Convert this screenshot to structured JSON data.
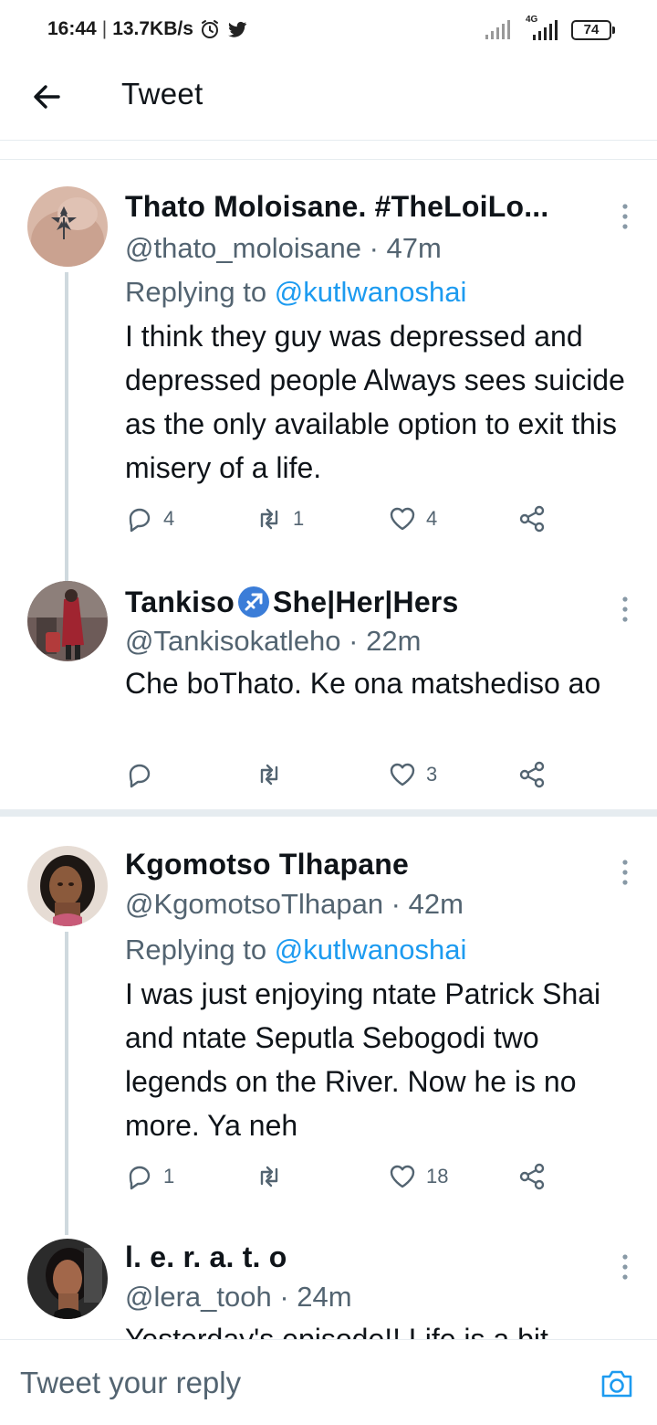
{
  "status_bar": {
    "time": "16:44",
    "net_speed": "13.7KB/s",
    "network_label": "4G",
    "battery": "74"
  },
  "header": {
    "title": "Tweet"
  },
  "tweets": [
    {
      "name": "Thato Moloisane. #TheLoiLo...",
      "handle_time": "@thato_moloisane · 47m",
      "replying_prefix": "Replying to ",
      "replying_to": "@kutlwanoshai",
      "text": "I think they guy was depressed and depressed people Always sees suicide as the only available option to exit this misery of a life.",
      "replies": "4",
      "retweets": "1",
      "likes": "4"
    },
    {
      "name": "Tankiso♐️She|Her|Hers",
      "name_plain": "Tankiso",
      "name_suffix": "She|Her|Hers",
      "handle_time": "@Tankisokatleho · 22m",
      "text": "Che boThato. Ke ona matshediso ao",
      "replies": "",
      "retweets": "",
      "likes": "3"
    },
    {
      "name": "Kgomotso Tlhapane",
      "handle_time": "@KgomotsoTlhapan · 42m",
      "replying_prefix": "Replying to ",
      "replying_to": "@kutlwanoshai",
      "text": "I was just enjoying ntate Patrick Shai and ntate Seputla Sebogodi two legends on the River. Now he is no more. Ya neh",
      "replies": "1",
      "retweets": "",
      "likes": "18"
    },
    {
      "name": "l. e. r. a. t. o",
      "handle_time": "@lera_tooh · 24m",
      "text": "Yesterday's episode!! Life is a bit"
    }
  ],
  "reply_bar": {
    "placeholder": "Tweet your reply"
  },
  "colors": {
    "accent": "#1d9bf0",
    "secondary_text": "#536471",
    "divider": "#e6ecf0",
    "thread_line": "#cfd9de"
  }
}
